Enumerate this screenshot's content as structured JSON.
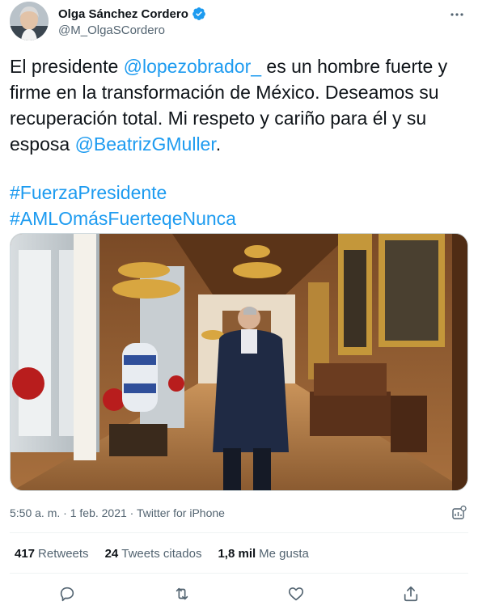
{
  "author": {
    "display_name": "Olga Sánchez Cordero",
    "handle": "@M_OlgaSCordero"
  },
  "icons": {
    "avatar": "profile-avatar",
    "verified": "verified-badge-icon",
    "more": "more-options-icon",
    "analytics": "analytics-icon",
    "reply": "reply-icon",
    "retweet": "retweet-icon",
    "like": "like-icon",
    "share": "share-icon"
  },
  "tweet": {
    "l1_pre": "El presidente ",
    "l1_mention": "@lopezobrador_",
    "l1_post": " es un hombre fuerte y",
    "l2": "firme en la transformación de México. Deseamos su",
    "l3": "recuperación total. Mi respeto y cariño para él y su",
    "l4_pre": "esposa ",
    "l4_mention": "@BeatrizGMuller",
    "l4_post": ".",
    "hashtag1": "#FuerzaPresidente",
    "hashtag2": "#AMLOmásFuerteqeNunca"
  },
  "meta": {
    "time": "5:50 a. m.",
    "sep1": " · ",
    "date": "1 feb. 2021",
    "sep2": " · ",
    "source": "Twitter for iPhone"
  },
  "stats": {
    "retweets_count": "417",
    "retweets_label": "Retweets",
    "quotes_count": "24",
    "quotes_label": "Tweets citados",
    "likes_count": "1,8 mil",
    "likes_label": "Me gusta"
  },
  "colors": {
    "link": "#1d9bf0",
    "text": "#0f1419",
    "muted": "#536471",
    "divider": "#eff3f4"
  }
}
